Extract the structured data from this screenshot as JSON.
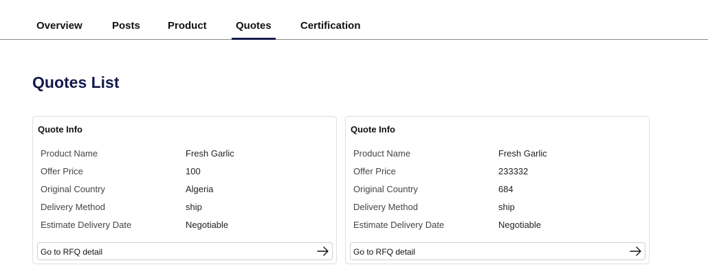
{
  "tabs": [
    {
      "label": "Overview"
    },
    {
      "label": "Posts"
    },
    {
      "label": "Product"
    },
    {
      "label": "Quotes",
      "active": true
    },
    {
      "label": "Certification"
    }
  ],
  "page_title": "Quotes List",
  "accent_color": "#141a4a",
  "quotes": [
    {
      "title": "Quote Info",
      "rows": [
        {
          "label": "Product Name",
          "value": "Fresh Garlic"
        },
        {
          "label": "Offer Price",
          "value": "100"
        },
        {
          "label": "Original Country",
          "value": "Algeria"
        },
        {
          "label": "Delivery Method",
          "value": "ship"
        },
        {
          "label": "Estimate Delivery Date",
          "value": "Negotiable"
        }
      ],
      "button": {
        "label": "Go to RFQ detail",
        "icon": "arrow-right-icon"
      }
    },
    {
      "title": "Quote Info",
      "rows": [
        {
          "label": "Product Name",
          "value": "Fresh Garlic"
        },
        {
          "label": "Offer Price",
          "value": "233332"
        },
        {
          "label": "Original Country",
          "value": "684"
        },
        {
          "label": "Delivery Method",
          "value": "ship"
        },
        {
          "label": "Estimate Delivery Date",
          "value": "Negotiable"
        }
      ],
      "button": {
        "label": "Go to RFQ detail",
        "icon": "arrow-right-icon"
      }
    }
  ]
}
